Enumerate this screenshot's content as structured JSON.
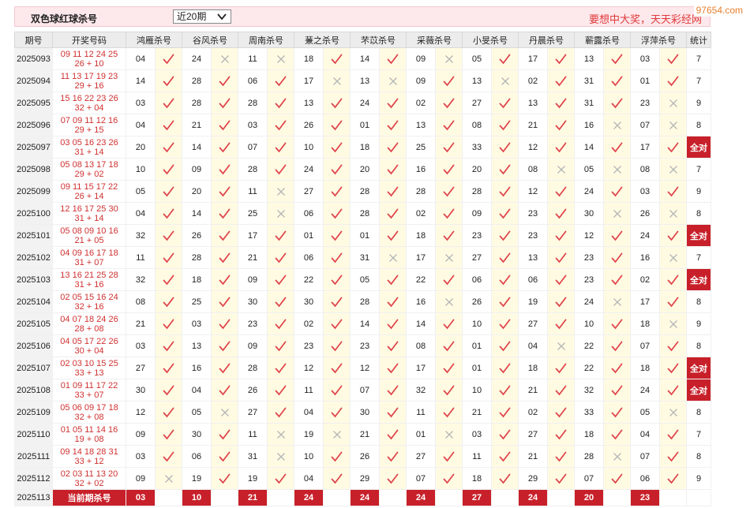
{
  "header": {
    "title": "双色球红球杀号",
    "period_select": "近20期",
    "slogan": "要想中大奖，天天彩经网",
    "watermark": "97654.com"
  },
  "columns": {
    "issue": "期号",
    "draw": "开奖号码",
    "experts": [
      "鸿雁杀号",
      "谷风杀号",
      "周南杀号",
      "蒹之杀号",
      "芣苡杀号",
      "采薇杀号",
      "小旻杀号",
      "丹晨杀号",
      "蕲露杀号",
      "浮萍杀号"
    ],
    "total": "统计"
  },
  "rows": [
    {
      "issue": "2025093",
      "nums": "09 11 12 24 25",
      "extra": "26 + 10",
      "kills": [
        [
          "04",
          1
        ],
        [
          "24",
          0
        ],
        [
          "11",
          0
        ],
        [
          "18",
          1
        ],
        [
          "14",
          1
        ],
        [
          "09",
          0
        ],
        [
          "05",
          1
        ],
        [
          "17",
          1
        ],
        [
          "13",
          1
        ],
        [
          "03",
          1
        ]
      ],
      "total": "7"
    },
    {
      "issue": "2025094",
      "nums": "11 13 17 19 23",
      "extra": "29 + 16",
      "kills": [
        [
          "14",
          1
        ],
        [
          "28",
          1
        ],
        [
          "06",
          1
        ],
        [
          "17",
          0
        ],
        [
          "13",
          0
        ],
        [
          "09",
          1
        ],
        [
          "13",
          0
        ],
        [
          "02",
          1
        ],
        [
          "31",
          1
        ],
        [
          "01",
          1
        ]
      ],
      "total": "7"
    },
    {
      "issue": "2025095",
      "nums": "15 16 22 23 26",
      "extra": "32 + 04",
      "kills": [
        [
          "03",
          1
        ],
        [
          "28",
          1
        ],
        [
          "28",
          1
        ],
        [
          "13",
          1
        ],
        [
          "24",
          1
        ],
        [
          "02",
          1
        ],
        [
          "27",
          1
        ],
        [
          "13",
          1
        ],
        [
          "31",
          1
        ],
        [
          "23",
          0
        ]
      ],
      "total": "9"
    },
    {
      "issue": "2025096",
      "nums": "07 09 11 12 16",
      "extra": "29 + 15",
      "kills": [
        [
          "04",
          1
        ],
        [
          "21",
          1
        ],
        [
          "03",
          1
        ],
        [
          "26",
          1
        ],
        [
          "01",
          1
        ],
        [
          "13",
          1
        ],
        [
          "08",
          1
        ],
        [
          "21",
          1
        ],
        [
          "16",
          0
        ],
        [
          "07",
          0
        ]
      ],
      "total": "8"
    },
    {
      "issue": "2025097",
      "nums": "03 05 16 23 26",
      "extra": "31 + 14",
      "kills": [
        [
          "20",
          1
        ],
        [
          "14",
          1
        ],
        [
          "07",
          1
        ],
        [
          "10",
          1
        ],
        [
          "18",
          1
        ],
        [
          "25",
          1
        ],
        [
          "33",
          1
        ],
        [
          "12",
          1
        ],
        [
          "14",
          1
        ],
        [
          "17",
          1
        ]
      ],
      "total": "全对"
    },
    {
      "issue": "2025098",
      "nums": "05 08 13 17 18",
      "extra": "29 + 02",
      "kills": [
        [
          "10",
          1
        ],
        [
          "09",
          1
        ],
        [
          "28",
          1
        ],
        [
          "24",
          1
        ],
        [
          "20",
          1
        ],
        [
          "16",
          1
        ],
        [
          "20",
          1
        ],
        [
          "08",
          0
        ],
        [
          "05",
          0
        ],
        [
          "08",
          0
        ]
      ],
      "total": "7"
    },
    {
      "issue": "2025099",
      "nums": "09 11 15 17 22",
      "extra": "26 + 14",
      "kills": [
        [
          "05",
          1
        ],
        [
          "20",
          1
        ],
        [
          "11",
          0
        ],
        [
          "27",
          1
        ],
        [
          "28",
          1
        ],
        [
          "28",
          1
        ],
        [
          "28",
          1
        ],
        [
          "12",
          1
        ],
        [
          "24",
          1
        ],
        [
          "03",
          1
        ]
      ],
      "total": "9"
    },
    {
      "issue": "2025100",
      "nums": "12 16 17 25 30",
      "extra": "31 + 14",
      "kills": [
        [
          "04",
          1
        ],
        [
          "14",
          1
        ],
        [
          "25",
          0
        ],
        [
          "06",
          1
        ],
        [
          "28",
          1
        ],
        [
          "02",
          1
        ],
        [
          "09",
          1
        ],
        [
          "23",
          1
        ],
        [
          "30",
          0
        ],
        [
          "26",
          0
        ]
      ],
      "total": "8"
    },
    {
      "issue": "2025101",
      "nums": "05 08 09 10 16",
      "extra": "21 + 05",
      "kills": [
        [
          "32",
          1
        ],
        [
          "26",
          1
        ],
        [
          "17",
          1
        ],
        [
          "01",
          1
        ],
        [
          "01",
          1
        ],
        [
          "18",
          1
        ],
        [
          "23",
          1
        ],
        [
          "23",
          1
        ],
        [
          "12",
          1
        ],
        [
          "24",
          1
        ]
      ],
      "total": "全对"
    },
    {
      "issue": "2025102",
      "nums": "04 09 16 17 18",
      "extra": "31 + 07",
      "kills": [
        [
          "11",
          1
        ],
        [
          "28",
          1
        ],
        [
          "21",
          1
        ],
        [
          "06",
          1
        ],
        [
          "31",
          0
        ],
        [
          "17",
          0
        ],
        [
          "27",
          1
        ],
        [
          "13",
          1
        ],
        [
          "23",
          1
        ],
        [
          "16",
          0
        ]
      ],
      "total": "7"
    },
    {
      "issue": "2025103",
      "nums": "13 16 21 25 28",
      "extra": "31 + 16",
      "kills": [
        [
          "32",
          1
        ],
        [
          "18",
          1
        ],
        [
          "09",
          1
        ],
        [
          "22",
          1
        ],
        [
          "05",
          1
        ],
        [
          "22",
          1
        ],
        [
          "06",
          1
        ],
        [
          "06",
          1
        ],
        [
          "23",
          1
        ],
        [
          "02",
          1
        ]
      ],
      "total": "全对"
    },
    {
      "issue": "2025104",
      "nums": "02 05 15 16 24",
      "extra": "32 + 16",
      "kills": [
        [
          "08",
          1
        ],
        [
          "25",
          1
        ],
        [
          "30",
          1
        ],
        [
          "30",
          1
        ],
        [
          "28",
          1
        ],
        [
          "16",
          0
        ],
        [
          "26",
          1
        ],
        [
          "19",
          1
        ],
        [
          "24",
          0
        ],
        [
          "17",
          1
        ]
      ],
      "total": "8"
    },
    {
      "issue": "2025105",
      "nums": "04 07 18 24 26",
      "extra": "28 + 08",
      "kills": [
        [
          "21",
          1
        ],
        [
          "03",
          1
        ],
        [
          "23",
          1
        ],
        [
          "02",
          1
        ],
        [
          "14",
          1
        ],
        [
          "14",
          1
        ],
        [
          "10",
          1
        ],
        [
          "27",
          1
        ],
        [
          "10",
          1
        ],
        [
          "18",
          0
        ]
      ],
      "total": "9"
    },
    {
      "issue": "2025106",
      "nums": "04 05 17 22 26",
      "extra": "30 + 04",
      "kills": [
        [
          "03",
          1
        ],
        [
          "13",
          1
        ],
        [
          "09",
          1
        ],
        [
          "23",
          1
        ],
        [
          "23",
          1
        ],
        [
          "08",
          1
        ],
        [
          "01",
          1
        ],
        [
          "04",
          0
        ],
        [
          "22",
          1
        ],
        [
          "07",
          1
        ]
      ],
      "total": "8"
    },
    {
      "issue": "2025107",
      "nums": "02 03 10 15 25",
      "extra": "33 + 13",
      "kills": [
        [
          "27",
          1
        ],
        [
          "16",
          1
        ],
        [
          "28",
          1
        ],
        [
          "12",
          1
        ],
        [
          "12",
          1
        ],
        [
          "17",
          1
        ],
        [
          "01",
          1
        ],
        [
          "18",
          1
        ],
        [
          "22",
          1
        ],
        [
          "18",
          1
        ]
      ],
      "total": "全对"
    },
    {
      "issue": "2025108",
      "nums": "01 09 11 17 22",
      "extra": "33 + 07",
      "kills": [
        [
          "30",
          1
        ],
        [
          "04",
          1
        ],
        [
          "26",
          1
        ],
        [
          "11",
          1
        ],
        [
          "07",
          1
        ],
        [
          "32",
          1
        ],
        [
          "10",
          1
        ],
        [
          "21",
          1
        ],
        [
          "32",
          1
        ],
        [
          "24",
          1
        ]
      ],
      "total": "全对"
    },
    {
      "issue": "2025109",
      "nums": "05 06 09 17 18",
      "extra": "32 + 08",
      "kills": [
        [
          "12",
          1
        ],
        [
          "05",
          0
        ],
        [
          "27",
          1
        ],
        [
          "04",
          1
        ],
        [
          "30",
          1
        ],
        [
          "11",
          1
        ],
        [
          "21",
          1
        ],
        [
          "02",
          1
        ],
        [
          "33",
          1
        ],
        [
          "05",
          0
        ]
      ],
      "total": "8"
    },
    {
      "issue": "2025110",
      "nums": "01 05 11 14 16",
      "extra": "19 + 08",
      "kills": [
        [
          "09",
          1
        ],
        [
          "30",
          1
        ],
        [
          "11",
          0
        ],
        [
          "19",
          0
        ],
        [
          "21",
          1
        ],
        [
          "01",
          0
        ],
        [
          "03",
          1
        ],
        [
          "27",
          1
        ],
        [
          "18",
          1
        ],
        [
          "04",
          1
        ]
      ],
      "total": "7"
    },
    {
      "issue": "2025111",
      "nums": "09 14 18 28 31",
      "extra": "33 + 12",
      "kills": [
        [
          "03",
          1
        ],
        [
          "06",
          1
        ],
        [
          "31",
          0
        ],
        [
          "10",
          1
        ],
        [
          "26",
          1
        ],
        [
          "27",
          1
        ],
        [
          "11",
          1
        ],
        [
          "21",
          1
        ],
        [
          "28",
          0
        ],
        [
          "07",
          1
        ]
      ],
      "total": "8"
    },
    {
      "issue": "2025112",
      "nums": "02 03 11 13 20",
      "extra": "32 + 02",
      "kills": [
        [
          "09",
          0
        ],
        [
          "19",
          1
        ],
        [
          "19",
          1
        ],
        [
          "04",
          1
        ],
        [
          "29",
          1
        ],
        [
          "07",
          1
        ],
        [
          "18",
          1
        ],
        [
          "29",
          1
        ],
        [
          "07",
          1
        ],
        [
          "06",
          1
        ]
      ],
      "total": "9"
    }
  ],
  "current": {
    "issue": "2025113",
    "label": "当前期杀号",
    "kills": [
      "03",
      "10",
      "21",
      "24",
      "24",
      "24",
      "27",
      "24",
      "20",
      "23"
    ]
  },
  "colors": {
    "accent_red": "#c8202a",
    "check_red": "#e0454a",
    "cross_gray": "#b5b5b5",
    "kill_cell_bg": "#fffbe3"
  }
}
